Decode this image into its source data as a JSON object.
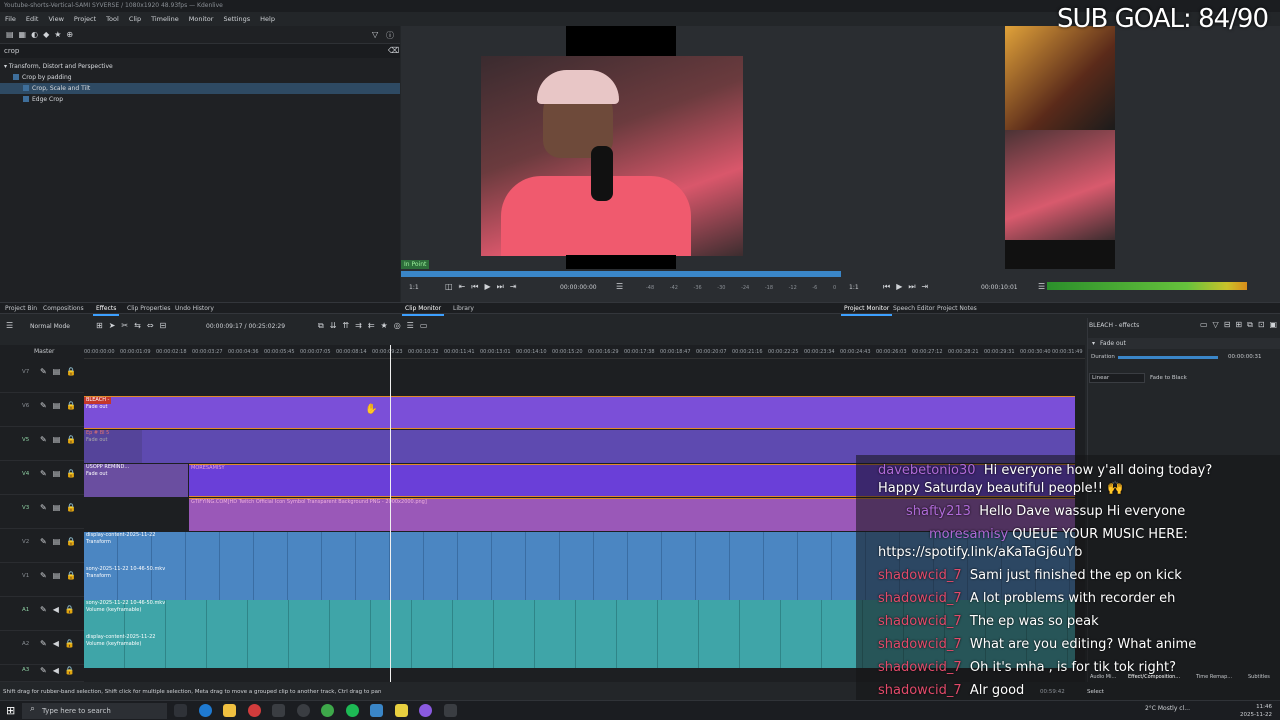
{
  "window": {
    "title": "Youtube-shorts-Vertical-SAMI SYVERSE / 1080x1920 48.93fps — Kdenlive"
  },
  "menu": [
    "File",
    "Edit",
    "View",
    "Project",
    "Tool",
    "Clip",
    "Timeline",
    "Monitor",
    "Settings",
    "Help"
  ],
  "effects": {
    "search_value": "crop",
    "category": "Transform, Distort and Perspective",
    "items": [
      "Crop by padding",
      "Crop, Scale and Tilt",
      "Edge Crop"
    ],
    "selected_index": 1
  },
  "overlay": {
    "sub_goal": "SUB GOAL: 84/90"
  },
  "clip_monitor": {
    "in_point": "In Point",
    "zoom": "1:1",
    "timecode": "00:00:00:00",
    "scale_labels": [
      "-48",
      "-42",
      "-36",
      "-30",
      "-24",
      "-18",
      "-12",
      "-6",
      "0"
    ]
  },
  "project_monitor": {
    "zoom": "1:1",
    "timecode": "00:00:10:01"
  },
  "tabs_left": [
    "Project Bin",
    "Compositions",
    "Effects",
    "Clip Properties",
    "Undo History"
  ],
  "tabs_mid": [
    "Clip Monitor",
    "Library"
  ],
  "tabs_right": [
    "Project Monitor",
    "Speech Editor",
    "Project Notes"
  ],
  "timeline_toolbar": {
    "mode": "Normal Mode",
    "timecode": "00:00:09:17 / 00:25:02:29"
  },
  "timeline": {
    "master": "Master",
    "ruler_ticks": [
      "00:00:00:00",
      "00:00:01:09",
      "00:00:02:18",
      "00:00:03:27",
      "00:00:04:36",
      "00:00:05:45",
      "00:00:07:05",
      "00:00:08:14",
      "00:00:09:23",
      "00:00:10:32",
      "00:00:11:41",
      "00:00:13:01",
      "00:00:14:10",
      "00:00:15:20",
      "00:00:16:29",
      "00:00:17:38",
      "00:00:18:47",
      "00:00:20:07",
      "00:00:21:16",
      "00:00:22:25",
      "00:00:23:34",
      "00:00:24:43",
      "00:00:26:03",
      "00:00:27:12",
      "00:00:28:21",
      "00:00:29:31",
      "00:00:30:40",
      "00:00:31:49"
    ],
    "tracks": [
      "V7",
      "V6",
      "V5",
      "V4",
      "V3",
      "V2",
      "V1",
      "A1",
      "A2",
      "A3"
    ],
    "clips": {
      "bleach": "BLEACH -",
      "fade_out": "Fade out",
      "ep5": "Ep # Bl 5",
      "usopp": "USOPP REMIND...",
      "moresamisy": "MORESAMISY",
      "twitch": "GTIFYING.COM[HD Twitch Official Icon Symbol Transparent Background PNG - 2000x2000.png]",
      "display": "display-content-2025-11-22",
      "transform": "Transform",
      "sony": "sony-2025-11-22 10-46-50.mkv",
      "volume": "Volume (keyframable)"
    }
  },
  "effect_stack": {
    "title": "BLEACH - effects",
    "effect": "Fade out",
    "duration_label": "Duration",
    "duration_value": "00:00:00:31",
    "curve": "Linear",
    "option": "Fade to Black"
  },
  "chat": [
    {
      "user": "davebetonio30",
      "text": "Hi everyone how y'all doing today?",
      "cont": "Happy Saturday beautiful people!! 🙌"
    },
    {
      "user": "shafty213",
      "text": "Hello Dave wassup Hi everyone"
    },
    {
      "user": "moresamisy",
      "text": "QUEUE YOUR MUSIC HERE:",
      "cont": "https://spotify.link/aKaTaGj6uYb"
    },
    {
      "user": "shadowcid_7",
      "text": "Sami just finished the ep on kick"
    },
    {
      "user": "shadowcid_7",
      "text": "A lot problems with recorder eh"
    },
    {
      "user": "shadowcid_7",
      "text": "The ep was so peak"
    },
    {
      "user": "shadowcid_7",
      "text": "What are you editing? What anime"
    },
    {
      "user": "shadowcid_7",
      "text": "Oh it's mha , is for tik tok right?"
    },
    {
      "user": "shadowcid_7",
      "text": "Alr good"
    }
  ],
  "status": {
    "hint": "Shift drag for rubber-band selection, Shift click for multiple selection, Meta drag to move a grouped clip to another track, Ctrl drag to pan",
    "select": "Select",
    "duration": "00:59:42"
  },
  "right_tabs": [
    "Audio Mi...",
    "Effect/Composition...",
    "Time Remap...",
    "Subtitles"
  ],
  "taskbar": {
    "search_placeholder": "Type here to search",
    "weather": "2°C Mostly cl...",
    "time": "11:46",
    "date": "2025-11-22"
  }
}
